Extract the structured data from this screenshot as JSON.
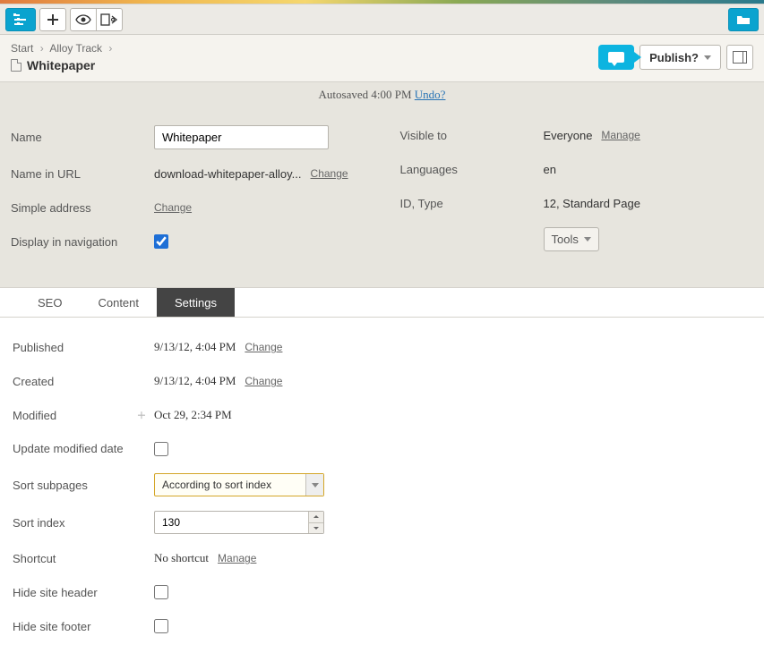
{
  "breadcrumb": {
    "start": "Start",
    "track": "Alloy Track"
  },
  "page_title": "Whitepaper",
  "publish_label": "Publish?",
  "autosave": {
    "text": "Autosaved 4:00 PM",
    "undo": "Undo?"
  },
  "form": {
    "name_label": "Name",
    "name_value": "Whitepaper",
    "url_label": "Name in URL",
    "url_value": "download-whitepaper-alloy...",
    "change": "Change",
    "simple_addr_label": "Simple address",
    "display_nav_label": "Display in navigation",
    "visible_label": "Visible to",
    "visible_value": "Everyone",
    "manage": "Manage",
    "languages_label": "Languages",
    "languages_value": "en",
    "idtype_label": "ID, Type",
    "idtype_value": "12, Standard Page",
    "tools": "Tools"
  },
  "tabs": {
    "seo": "SEO",
    "content": "Content",
    "settings": "Settings"
  },
  "settings": {
    "published_label": "Published",
    "published_value": "9/13/12, 4:04 PM",
    "created_label": "Created",
    "created_value": "9/13/12, 4:04 PM",
    "modified_label": "Modified",
    "modified_value": "Oct 29, 2:34 PM",
    "update_mod_label": "Update modified date",
    "sort_sub_label": "Sort subpages",
    "sort_sub_value": "According to sort index",
    "sort_idx_label": "Sort index",
    "sort_idx_value": "130",
    "shortcut_label": "Shortcut",
    "shortcut_value": "No shortcut",
    "hide_header_label": "Hide site header",
    "hide_footer_label": "Hide site footer",
    "change": "Change",
    "manage": "Manage"
  }
}
